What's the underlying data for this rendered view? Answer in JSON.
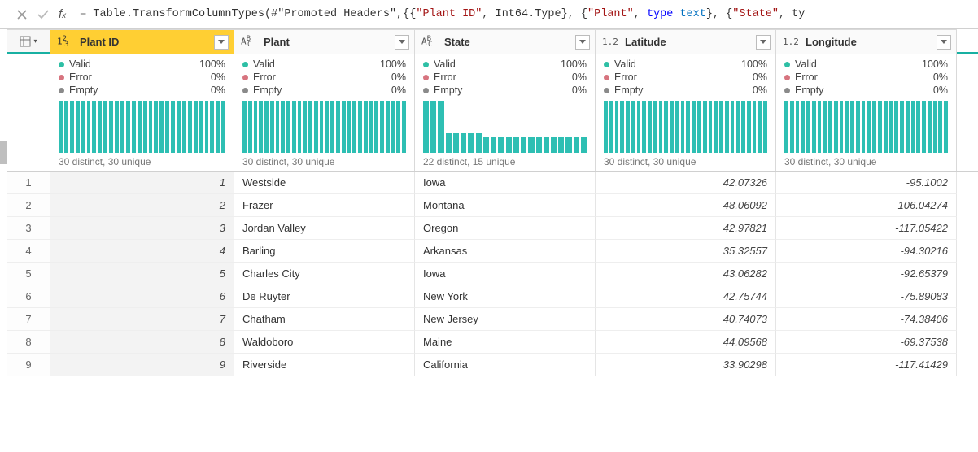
{
  "formula": {
    "prefix": "= ",
    "fn": "Table.TransformColumnTypes",
    "ref": "#\"Promoted Headers\"",
    "col1": "\"Plant ID\"",
    "type1": "Int64.Type",
    "col2": "\"Plant\"",
    "kw_type": "type",
    "type2": "text",
    "col3": "\"State\"",
    "tail": "ty"
  },
  "columns": [
    {
      "name": "Plant ID",
      "type_icon": "int",
      "selected": true,
      "quality": {
        "valid": "100%",
        "error": "0%",
        "empty": "0%"
      },
      "distinct": "30 distinct, 30 unique",
      "histogram": "flat"
    },
    {
      "name": "Plant",
      "type_icon": "abc",
      "selected": false,
      "quality": {
        "valid": "100%",
        "error": "0%",
        "empty": "0%"
      },
      "distinct": "30 distinct, 30 unique",
      "histogram": "flat"
    },
    {
      "name": "State",
      "type_icon": "abc",
      "selected": false,
      "quality": {
        "valid": "100%",
        "error": "0%",
        "empty": "0%"
      },
      "distinct": "22 distinct, 15 unique",
      "histogram": "step"
    },
    {
      "name": "Latitude",
      "type_icon": "dec",
      "selected": false,
      "quality": {
        "valid": "100%",
        "error": "0%",
        "empty": "0%"
      },
      "distinct": "30 distinct, 30 unique",
      "histogram": "flat"
    },
    {
      "name": "Longitude",
      "type_icon": "dec",
      "selected": false,
      "quality": {
        "valid": "100%",
        "error": "0%",
        "empty": "0%"
      },
      "distinct": "30 distinct, 30 unique",
      "histogram": "flat"
    }
  ],
  "q_labels": {
    "valid": "Valid",
    "error": "Error",
    "empty": "Empty"
  },
  "rows": [
    {
      "n": "1",
      "id": "1",
      "plant": "Westside",
      "state": "Iowa",
      "lat": "42.07326",
      "lon": "-95.1002"
    },
    {
      "n": "2",
      "id": "2",
      "plant": "Frazer",
      "state": "Montana",
      "lat": "48.06092",
      "lon": "-106.04274"
    },
    {
      "n": "3",
      "id": "3",
      "plant": "Jordan Valley",
      "state": "Oregon",
      "lat": "42.97821",
      "lon": "-117.05422"
    },
    {
      "n": "4",
      "id": "4",
      "plant": "Barling",
      "state": "Arkansas",
      "lat": "35.32557",
      "lon": "-94.30216"
    },
    {
      "n": "5",
      "id": "5",
      "plant": "Charles City",
      "state": "Iowa",
      "lat": "43.06282",
      "lon": "-92.65379"
    },
    {
      "n": "6",
      "id": "6",
      "plant": "De Ruyter",
      "state": "New York",
      "lat": "42.75744",
      "lon": "-75.89083"
    },
    {
      "n": "7",
      "id": "7",
      "plant": "Chatham",
      "state": "New Jersey",
      "lat": "40.74073",
      "lon": "-74.38406"
    },
    {
      "n": "8",
      "id": "8",
      "plant": "Waldoboro",
      "state": "Maine",
      "lat": "44.09568",
      "lon": "-69.37538"
    },
    {
      "n": "9",
      "id": "9",
      "plant": "Riverside",
      "state": "California",
      "lat": "33.90298",
      "lon": "-117.41429"
    }
  ],
  "chart_data": [
    {
      "type": "bar",
      "title": "Plant ID distribution",
      "bars": 30,
      "pattern": "flat",
      "value": 64
    },
    {
      "type": "bar",
      "title": "Plant distribution",
      "bars": 30,
      "pattern": "flat",
      "value": 64
    },
    {
      "type": "bar",
      "title": "State distribution",
      "bars": 22,
      "pattern": "step",
      "values": [
        64,
        64,
        64,
        24,
        24,
        24,
        24,
        24,
        20,
        20,
        20,
        20,
        20,
        20,
        20,
        20,
        20,
        20,
        20,
        20,
        20,
        20
      ]
    },
    {
      "type": "bar",
      "title": "Latitude distribution",
      "bars": 30,
      "pattern": "flat",
      "value": 64
    },
    {
      "type": "bar",
      "title": "Longitude distribution",
      "bars": 30,
      "pattern": "flat",
      "value": 64
    }
  ]
}
